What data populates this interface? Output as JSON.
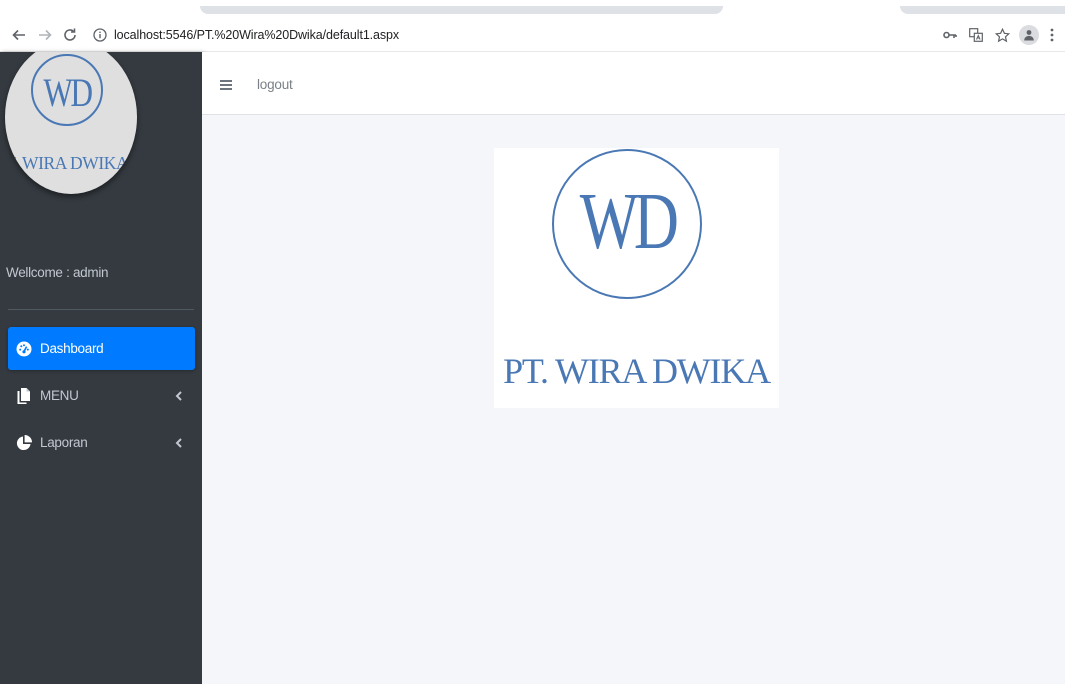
{
  "browser": {
    "url_host": "localhost:5546",
    "url_path": "/PT.%20Wira%20Dwika/default1.aspx"
  },
  "sidebar": {
    "brand_mark": "WD",
    "brand_name": "PT. WIRA DWIKA",
    "welcome": "Wellcome : admin",
    "items": [
      {
        "label": "Dashboard",
        "icon": "tachometer-icon",
        "active": true
      },
      {
        "label": "MENU",
        "icon": "copy-icon",
        "active": false
      },
      {
        "label": "Laporan",
        "icon": "pie-chart-icon",
        "active": false
      }
    ]
  },
  "topnav": {
    "logout_label": "logout"
  },
  "content": {
    "logo_mark": "WD",
    "logo_company": "PT. WIRA DWIKA"
  },
  "colors": {
    "sidebar_bg": "#343a40",
    "active_item": "#007bff",
    "content_bg": "#f4f6f9",
    "logo_blue": "#4a78b5"
  }
}
